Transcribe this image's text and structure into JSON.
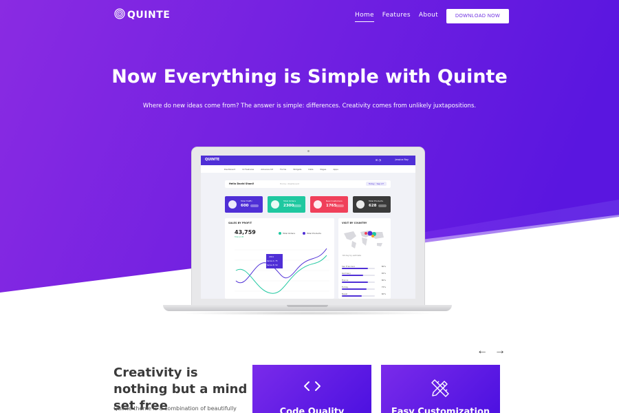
{
  "brand": {
    "name": "QUINTE"
  },
  "nav": {
    "items": [
      {
        "label": "Home",
        "active": true
      },
      {
        "label": "Features",
        "active": false
      },
      {
        "label": "About",
        "active": false
      }
    ],
    "cta": "DOWNLOAD NOW"
  },
  "hero": {
    "title": "Now Everything is Simple with Quinte",
    "subtitle": "Where do new ideas come from? The answer is simple: differences. Creativity comes from unlikely juxtapositions."
  },
  "dashboard": {
    "logo": "QUINTE",
    "user": "Jessica Roy",
    "menu": [
      "Dashboard",
      "UI Features",
      "Advance Kit",
      "Forms",
      "Widgets",
      "Data",
      "Pages",
      "Apps"
    ],
    "greeting": "Hello David Shani!",
    "breadcrumb": "Home / Dashboard",
    "date_chip": "Today : Sep 27",
    "tiles": [
      {
        "label": "Total Traffic",
        "value": "600",
        "color": "#4f2fd6"
      },
      {
        "label": "Total Orders",
        "value": "2300",
        "color": "#1fc8a0"
      },
      {
        "label": "New Customers",
        "value": "1765",
        "color": "#f0405a"
      },
      {
        "label": "Total Products",
        "value": "628",
        "color": "#3a3a3a"
      }
    ],
    "sales_card": {
      "title": "SALES BY PROFIT",
      "total": "43,759",
      "sub": "Total profit",
      "legend": [
        {
          "name": "Total Orders",
          "color": "#1fc8a0"
        },
        {
          "name": "Total Products",
          "color": "#4f2fd6"
        }
      ],
      "tooltip": {
        "title": "2011",
        "l1": "Series A: 75",
        "l2": "Series B: 50"
      }
    },
    "country_card": {
      "title": "VISIT BY COUNTRY",
      "note": "60 day by estimate",
      "rows": [
        {
          "name": "San Francisco",
          "pct": "80%",
          "fill": 0.8
        },
        {
          "name": "Germany",
          "pct": "65%",
          "fill": 0.65
        },
        {
          "name": "France",
          "pct": "80%",
          "fill": 0.8
        },
        {
          "name": "Turkey",
          "pct": "75%",
          "fill": 0.75
        },
        {
          "name": "Nepal",
          "pct": "60%",
          "fill": 0.6
        }
      ]
    }
  },
  "carousel": {
    "prev": "←",
    "next": "→"
  },
  "section": {
    "title": "Creativity is nothing but a mind set free",
    "text": "Quinte theme is a combination of beautifully"
  },
  "features": [
    {
      "title": "Code Quality",
      "icon": "code-icon"
    },
    {
      "title": "Easy Customization",
      "icon": "pencil-ruler-icon"
    }
  ],
  "colors": {
    "accent": "#7a2bea",
    "accent_dark": "#4b10e0",
    "white": "#ffffff"
  }
}
